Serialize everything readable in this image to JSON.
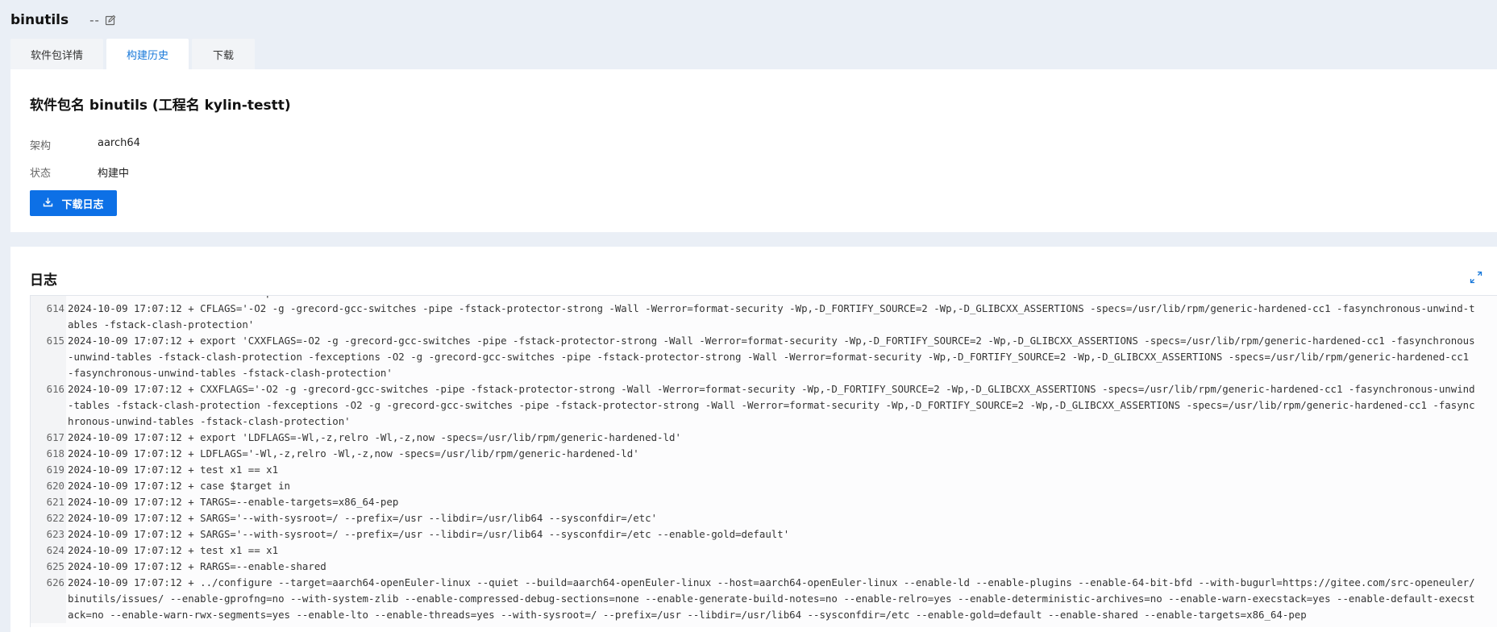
{
  "header": {
    "package_name": "binutils",
    "description": "--"
  },
  "tabs": [
    {
      "label": "软件包详情",
      "active": false
    },
    {
      "label": "构建历史",
      "active": true
    },
    {
      "label": "下载",
      "active": false
    }
  ],
  "info": {
    "title": "软件包名 binutils (工程名 kylin-testt)",
    "arch_label": "架构",
    "arch_value": "aarch64",
    "status_label": "状态",
    "status_value": "构建中",
    "download_button": "下载日志"
  },
  "log": {
    "title": "日志",
    "lines": [
      {
        "n": "",
        "text": "nous-unwind-tables -fstack-clash-protection"
      },
      {
        "n": "614",
        "text": "2024-10-09 17:07:12 + CFLAGS='-O2 -g -grecord-gcc-switches -pipe -fstack-protector-strong -Wall -Werror=format-security -Wp,-D_FORTIFY_SOURCE=2 -Wp,-D_GLIBCXX_ASSERTIONS -specs=/usr/lib/rpm/generic-hardened-cc1 -fasynchronous-unwind-tables -fstack-clash-protection'"
      },
      {
        "n": "615",
        "text": "2024-10-09 17:07:12 + export 'CXXFLAGS=-O2 -g -grecord-gcc-switches -pipe -fstack-protector-strong -Wall -Werror=format-security -Wp,-D_FORTIFY_SOURCE=2 -Wp,-D_GLIBCXX_ASSERTIONS -specs=/usr/lib/rpm/generic-hardened-cc1 -fasynchronous-unwind-tables -fstack-clash-protection -fexceptions -O2 -g -grecord-gcc-switches -pipe -fstack-protector-strong -Wall -Werror=format-security -Wp,-D_FORTIFY_SOURCE=2 -Wp,-D_GLIBCXX_ASSERTIONS -specs=/usr/lib/rpm/generic-hardened-cc1 -fasynchronous-unwind-tables -fstack-clash-protection'"
      },
      {
        "n": "616",
        "text": "2024-10-09 17:07:12 + CXXFLAGS='-O2 -g -grecord-gcc-switches -pipe -fstack-protector-strong -Wall -Werror=format-security -Wp,-D_FORTIFY_SOURCE=2 -Wp,-D_GLIBCXX_ASSERTIONS -specs=/usr/lib/rpm/generic-hardened-cc1 -fasynchronous-unwind-tables -fstack-clash-protection -fexceptions -O2 -g -grecord-gcc-switches -pipe -fstack-protector-strong -Wall -Werror=format-security -Wp,-D_FORTIFY_SOURCE=2 -Wp,-D_GLIBCXX_ASSERTIONS -specs=/usr/lib/rpm/generic-hardened-cc1 -fasynchronous-unwind-tables -fstack-clash-protection'"
      },
      {
        "n": "617",
        "text": "2024-10-09 17:07:12 + export 'LDFLAGS=-Wl,-z,relro -Wl,-z,now -specs=/usr/lib/rpm/generic-hardened-ld'"
      },
      {
        "n": "618",
        "text": "2024-10-09 17:07:12 + LDFLAGS='-Wl,-z,relro -Wl,-z,now -specs=/usr/lib/rpm/generic-hardened-ld'"
      },
      {
        "n": "619",
        "text": "2024-10-09 17:07:12 + test x1 == x1"
      },
      {
        "n": "620",
        "text": "2024-10-09 17:07:12 + case $target in"
      },
      {
        "n": "621",
        "text": "2024-10-09 17:07:12 + TARGS=--enable-targets=x86_64-pep"
      },
      {
        "n": "622",
        "text": "2024-10-09 17:07:12 + SARGS='--with-sysroot=/ --prefix=/usr --libdir=/usr/lib64 --sysconfdir=/etc'"
      },
      {
        "n": "623",
        "text": "2024-10-09 17:07:12 + SARGS='--with-sysroot=/ --prefix=/usr --libdir=/usr/lib64 --sysconfdir=/etc --enable-gold=default'"
      },
      {
        "n": "624",
        "text": "2024-10-09 17:07:12 + test x1 == x1"
      },
      {
        "n": "625",
        "text": "2024-10-09 17:07:12 + RARGS=--enable-shared"
      },
      {
        "n": "626",
        "text": "2024-10-09 17:07:12 + ../configure --target=aarch64-openEuler-linux --quiet --build=aarch64-openEuler-linux --host=aarch64-openEuler-linux --enable-ld --enable-plugins --enable-64-bit-bfd --with-bugurl=https://gitee.com/src-openeuler/binutils/issues/ --enable-gprofng=no --with-system-zlib --enable-compressed-debug-sections=none --enable-generate-build-notes=no --enable-relro=yes --enable-deterministic-archives=no --enable-warn-execstack=yes --enable-default-execstack=no --enable-warn-rwx-segments=yes --enable-lto --enable-threads=yes --with-sysroot=/ --prefix=/usr --libdir=/usr/lib64 --sysconfdir=/etc --enable-gold=default --enable-shared --enable-targets=x86_64-pep"
      }
    ]
  },
  "colors": {
    "accent": "#0d70e6",
    "active_tab_text": "#1677d9",
    "page_bg": "#eaeff6"
  }
}
